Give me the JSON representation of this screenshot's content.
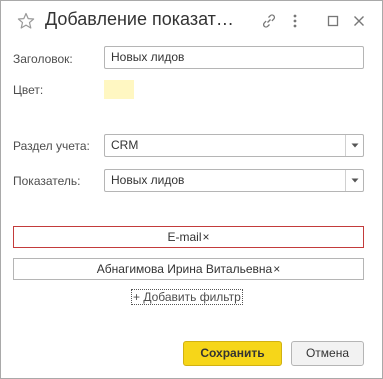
{
  "window": {
    "title": "Добавление показат…"
  },
  "form": {
    "heading_label": "Заголовок:",
    "heading_value": "Новых лидов",
    "color_label": "Цвет:",
    "color_value": "#fff7c2",
    "section_label": "Раздел учета:",
    "section_value": "CRM",
    "indicator_label": "Показатель:",
    "indicator_value": "Новых лидов"
  },
  "filters": {
    "items": [
      {
        "label": "E-mail",
        "remove": "×"
      },
      {
        "label": "Абнагимова Ирина Витальевна",
        "remove": "×"
      }
    ],
    "add_label": "+ Добавить фильтр"
  },
  "buttons": {
    "save": "Сохранить",
    "cancel": "Отмена"
  },
  "colors": {
    "primary_button": "#f6d619",
    "active_filter_border": "#c33b3b"
  }
}
